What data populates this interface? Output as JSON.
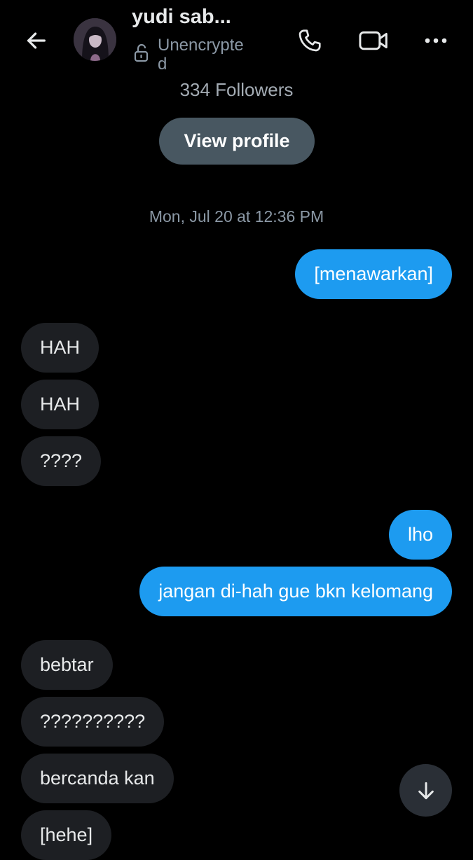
{
  "header": {
    "contact_name": "yudi sab...",
    "encryption_status": "Unencrypted",
    "icons": {
      "back": "arrow-left-icon",
      "lock": "unlock-icon",
      "call": "phone-icon",
      "video": "video-camera-icon",
      "more": "more-horizontal-icon"
    }
  },
  "profile_summary": {
    "followers": "334 Followers",
    "view_profile_label": "View profile"
  },
  "conversation": {
    "date_separator": "Mon, Jul 20 at 12:36 PM",
    "messages": [
      {
        "direction": "outgoing",
        "text": "[menawarkan]"
      },
      {
        "direction": "incoming",
        "text": "HAH"
      },
      {
        "direction": "incoming",
        "text": "HAH"
      },
      {
        "direction": "incoming",
        "text": "????"
      },
      {
        "direction": "outgoing",
        "text": "lho"
      },
      {
        "direction": "outgoing",
        "text": "jangan di-hah gue bkn kelomang"
      },
      {
        "direction": "incoming",
        "text": "bebtar"
      },
      {
        "direction": "incoming",
        "text": "??????????"
      },
      {
        "direction": "incoming",
        "text": "bercanda kan"
      },
      {
        "direction": "incoming",
        "text": "[hehe]"
      }
    ]
  },
  "scroll_down_icon": "arrow-down-icon",
  "colors": {
    "background": "#000000",
    "outgoing_bubble": "#1d9bf0",
    "incoming_bubble": "#1d1f23",
    "view_profile_button": "#485761",
    "secondary_text": "#8b98a5"
  }
}
